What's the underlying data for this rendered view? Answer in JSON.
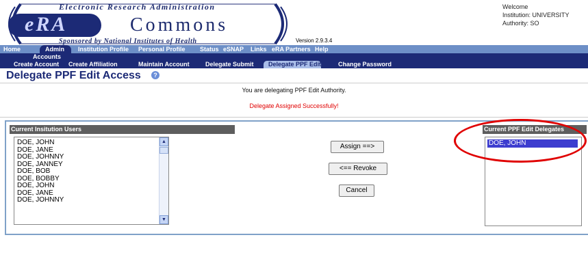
{
  "banner": {
    "tagline": "Electronic Research Administration",
    "logo_left": "eRA",
    "logo_right": "Commons",
    "sponsor": "Sponsored by National Institutes of Health",
    "version": "Version 2.9.3.4"
  },
  "user": {
    "welcome": "Welcome",
    "institution": "Institution: UNIVERSITY",
    "authority": "Authority:  SO"
  },
  "nav_primary": [
    "Home",
    "Admin",
    "Institution Profile",
    "Personal Profile",
    "Status",
    "eSNAP",
    "Links",
    "eRA Partners",
    "Help"
  ],
  "nav_secondary": {
    "group_label": "Accounts",
    "items": [
      "Create Account",
      "Create Affiliation",
      "Maintain Account",
      "Delegate Submit",
      "Delegate PPF Edit",
      "Change Password"
    ],
    "selected": "Delegate PPF Edit"
  },
  "page": {
    "title": "Delegate PPF Edit Access",
    "help_icon": "?",
    "info_message": "You are delegating PPF Edit Authority.",
    "success_message": "Delegate Assigned Successfully!"
  },
  "left_panel": {
    "header": "Current Insitution Users",
    "users": [
      "DOE, JOHN",
      "DOE, JANE",
      "DOE, JOHNNY",
      "DOE, JANNEY",
      "DOE, BOB",
      "DOE, BOBBY",
      "DOE, JOHN",
      "DOE, JANE",
      "DOE, JOHNNY"
    ]
  },
  "buttons": {
    "assign": "Assign ==>",
    "revoke": "<== Revoke",
    "cancel": "Cancel"
  },
  "right_panel": {
    "header": "Current PPF Edit Delegates",
    "delegates": [
      "DOE, JOHN"
    ]
  },
  "colors": {
    "navy": "#1c2a76",
    "nav_light": "#6d8fc7",
    "success_red": "#e00000",
    "selection_blue": "#3d3dcf"
  }
}
